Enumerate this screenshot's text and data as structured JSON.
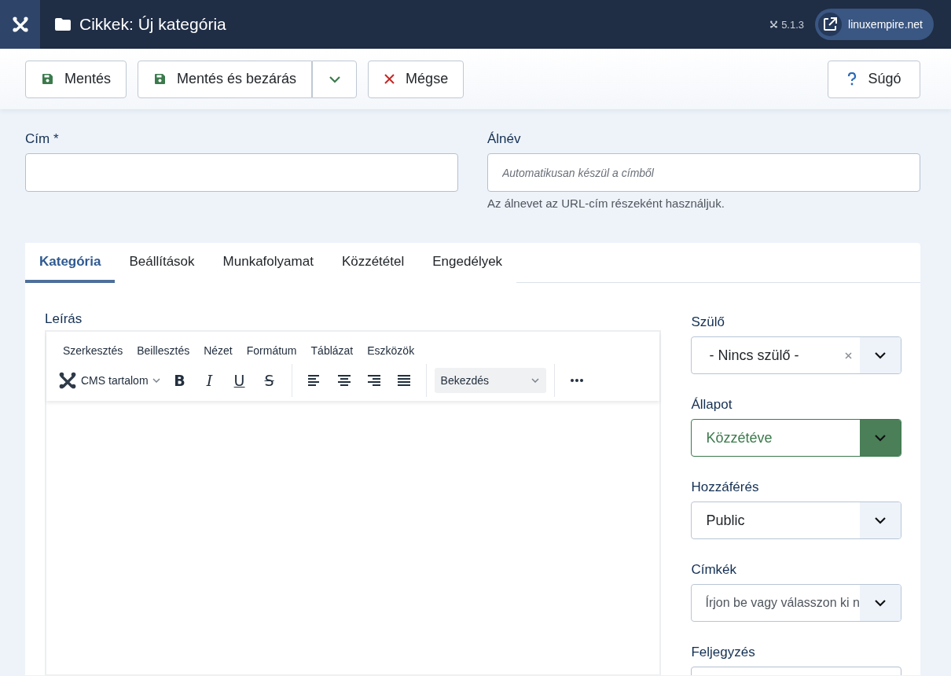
{
  "header": {
    "title": "Cikkek: Új kategória",
    "version": "5.1.3",
    "site": "linuxempire.net"
  },
  "toolbar": {
    "buttons": [
      {
        "kind": "save",
        "label": "Mentés",
        "dropdown": false
      },
      {
        "kind": "save",
        "label": "Mentés és bezárás",
        "dropdown": true
      },
      {
        "kind": "cancel",
        "label": "Mégse",
        "dropdown": false
      }
    ],
    "help": {
      "kind": "help",
      "label": "Súgó"
    }
  },
  "title_field": {
    "label": "Cím *"
  },
  "alias_field": {
    "label": "Álnév",
    "placeholder": "Automatikusan készül a címből",
    "hint": "Az álnevet az URL-cím részeként használjuk."
  },
  "tabs": [
    {
      "label": "Kategória",
      "selected": true
    },
    {
      "label": "Beállítások",
      "selected": false
    },
    {
      "label": "Munkafolyamat",
      "selected": false
    },
    {
      "label": "Közzététel",
      "selected": false
    },
    {
      "label": "Engedélyek",
      "selected": false
    }
  ],
  "editor": {
    "label": "Leírás",
    "menu": [
      "Szerkesztés",
      "Beillesztés",
      "Nézet",
      "Formátum",
      "Táblázat",
      "Eszközök"
    ],
    "cms_content": "CMS tartalom",
    "tools": [
      {
        "kind": "bold",
        "label": "B"
      },
      {
        "kind": "italic",
        "label": "I"
      },
      {
        "kind": "underline",
        "label": "U"
      },
      {
        "kind": "strike",
        "label": "S"
      },
      {
        "kind": "align-left"
      },
      {
        "kind": "align-center"
      },
      {
        "kind": "align-right"
      },
      {
        "kind": "justify"
      }
    ],
    "block_format": "Bekezdés"
  },
  "side_fields": [
    {
      "kind": "select",
      "label": "Szülő",
      "value": "- Nincs szülő -",
      "clearable": true,
      "published": false
    },
    {
      "kind": "select",
      "label": "Állapot",
      "value": "Közzétéve",
      "clearable": false,
      "published": true
    },
    {
      "kind": "select",
      "label": "Hozzáférés",
      "value": "Public",
      "clearable": false,
      "published": false
    },
    {
      "kind": "tags",
      "label": "Címkék",
      "placeholder": "Írjon be vagy válasszon ki n"
    },
    {
      "kind": "text",
      "label": "Feljegyzés"
    }
  ]
}
